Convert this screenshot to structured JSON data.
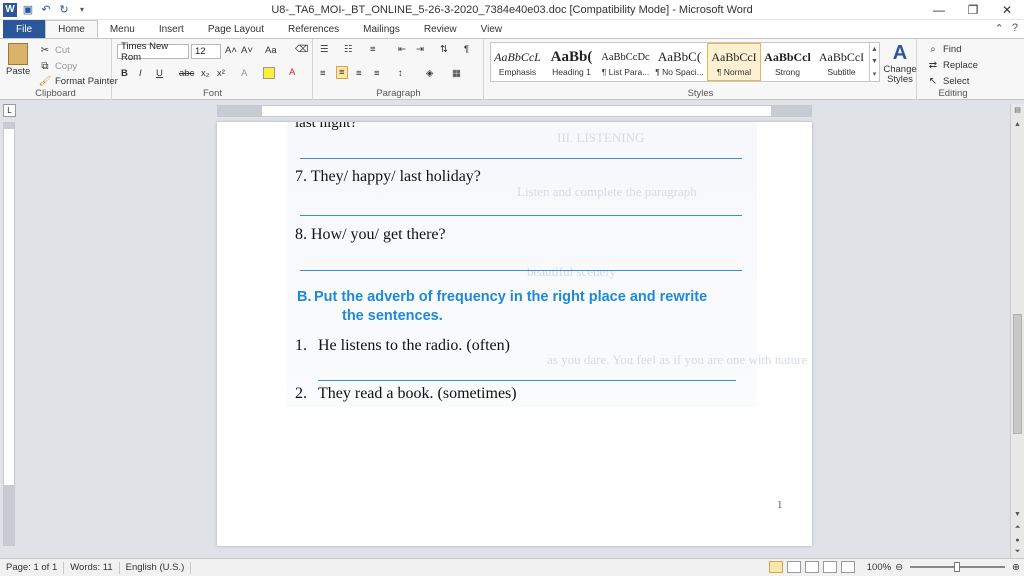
{
  "window": {
    "title": "U8-_TA6_MOI-_BT_ONLINE_5-26-3-2020_7384e40e03.doc [Compatibility Mode] - Microsoft Word",
    "app_logo": "W",
    "controls": {
      "minimize": "—",
      "maximize": "❐",
      "close": "✕"
    }
  },
  "tabs": [
    "File",
    "Home",
    "Menu",
    "Insert",
    "Page Layout",
    "References",
    "Mailings",
    "Review",
    "View"
  ],
  "active_tab": "Home",
  "ribbon": {
    "clipboard": {
      "paste": "Paste",
      "cut": "Cut",
      "copy": "Copy",
      "format_painter": "Format Painter",
      "label": "Clipboard"
    },
    "font": {
      "family": "Times New Rom",
      "size": "12",
      "label": "Font",
      "bold": "B",
      "italic": "I",
      "underline": "U",
      "strike": "abc",
      "sub": "x₂",
      "sup": "x²",
      "grow": "A˄",
      "shrink": "A˅",
      "case": "Aa",
      "clear": "A"
    },
    "paragraph": {
      "label": "Paragraph",
      "pilcrow": "¶"
    },
    "styles": {
      "label": "Styles",
      "items": [
        {
          "preview": "AaBbCcL",
          "name": "Emphasis"
        },
        {
          "preview": "AaBb(",
          "name": "Heading 1"
        },
        {
          "preview": "AaBbCcDc",
          "name": "¶ List Para..."
        },
        {
          "preview": "AaBbC(",
          "name": "¶ No Spaci..."
        },
        {
          "preview": "AaBbCcI",
          "name": "¶ Normal"
        },
        {
          "preview": "AaBbCcl",
          "name": "Strong"
        },
        {
          "preview": "AaBbCcI",
          "name": "Subtitle"
        }
      ],
      "change_styles": "Change Styles"
    },
    "editing": {
      "label": "Editing",
      "find": "Find",
      "replace": "Replace",
      "select": "Select"
    }
  },
  "document": {
    "partial_top": "last night?",
    "q7": "7. They/ happy/ last holiday?",
    "q8": "8. How/ you/ get there?",
    "section_letter": "B.",
    "section_line1": "Put the adverb of frequency in the right place and rewrite",
    "section_line2": "the sentences.",
    "item1_num": "1.",
    "item1": "He listens to the radio. (often)",
    "item2_num": "2.",
    "item2": "They read a book. (sometimes)",
    "page_number": "1"
  },
  "status": {
    "page": "Page: 1 of 1",
    "words": "Words: 11",
    "language": "English (U.S.)",
    "zoom": "100%"
  },
  "colors": {
    "accent": "#2b579a",
    "heading": "#1e8ad6",
    "rule_line": "#3b8fd1"
  }
}
